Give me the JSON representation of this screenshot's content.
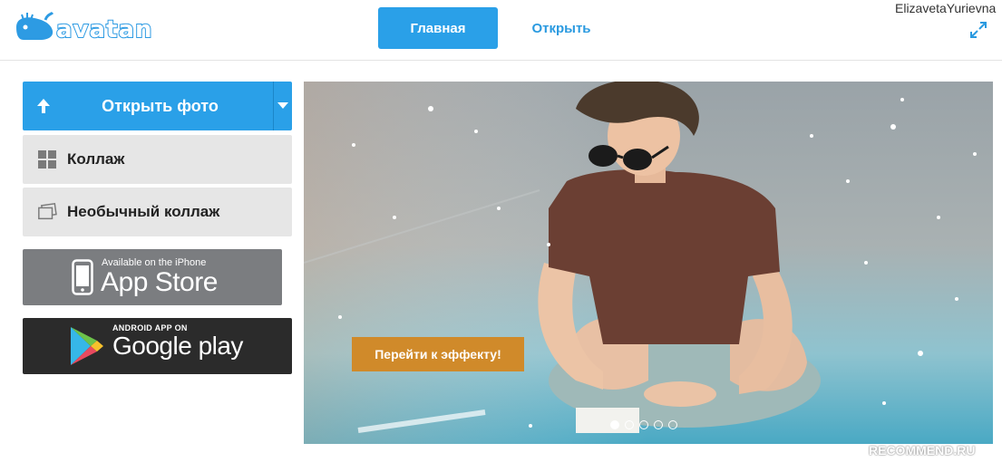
{
  "header": {
    "logo_text": "avatan",
    "nav": {
      "home_label": "Главная",
      "open_label": "Открыть"
    },
    "username": "ElizavetaYurievna",
    "expand_icon": "expand-icon"
  },
  "sidebar": {
    "open_photo_label": "Открыть фото",
    "collage_label": "Коллаж",
    "unusual_collage_label": "Необычный коллаж",
    "appstore": {
      "small": "Available on the iPhone",
      "big": "App Store"
    },
    "googleplay": {
      "small": "ANDROID APP ON",
      "big": "Google play"
    }
  },
  "hero": {
    "cta_label": "Перейти к эффекту!",
    "slides_total": 5,
    "active_slide": 1
  },
  "watermark": "RECOMMEND.RU",
  "colors": {
    "accent": "#2aa0e8",
    "cta": "#d08a2a",
    "menu_bg": "#e6e6e6"
  }
}
